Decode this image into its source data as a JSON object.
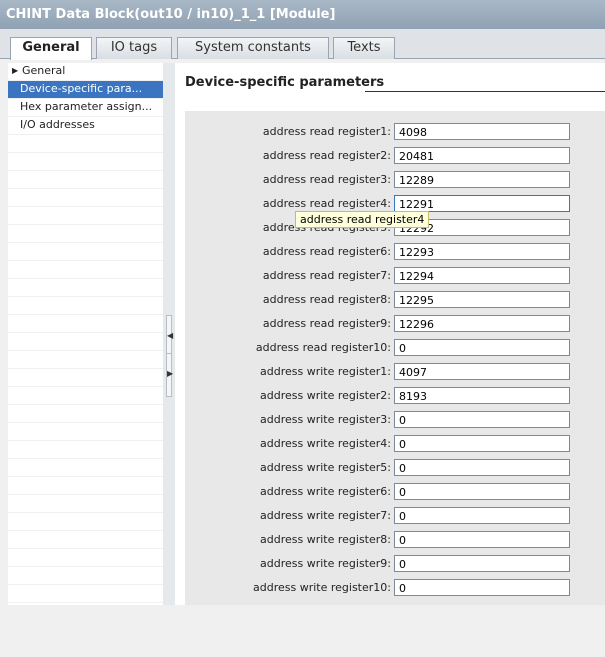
{
  "window": {
    "title": "CHINT Data Block(out10 / in10)_1_1 [Module]"
  },
  "tabs": [
    {
      "label": "General"
    },
    {
      "label": "IO tags"
    },
    {
      "label": "System constants"
    },
    {
      "label": "Texts"
    }
  ],
  "nav": {
    "items": [
      {
        "label": "General"
      },
      {
        "label": "Device-specific para..."
      },
      {
        "label": "Hex parameter assign..."
      },
      {
        "label": "I/O addresses"
      }
    ]
  },
  "section": {
    "title": "Device-specific parameters"
  },
  "params": [
    {
      "label": "address read register1:",
      "value": "4098"
    },
    {
      "label": "address read register2:",
      "value": "20481"
    },
    {
      "label": "address read register3:",
      "value": "12289"
    },
    {
      "label": "address read register4:",
      "value": "12291"
    },
    {
      "label": "address read register5:",
      "value": "12292"
    },
    {
      "label": "address read register6:",
      "value": "12293"
    },
    {
      "label": "address read register7:",
      "value": "12294"
    },
    {
      "label": "address read register8:",
      "value": "12295"
    },
    {
      "label": "address read register9:",
      "value": "12296"
    },
    {
      "label": "address read register10:",
      "value": "0"
    },
    {
      "label": "address write register1:",
      "value": "4097"
    },
    {
      "label": "address write register2:",
      "value": "8193"
    },
    {
      "label": "address write register3:",
      "value": "0"
    },
    {
      "label": "address write register4:",
      "value": "0"
    },
    {
      "label": "address write register5:",
      "value": "0"
    },
    {
      "label": "address write register6:",
      "value": "0"
    },
    {
      "label": "address write register7:",
      "value": "0"
    },
    {
      "label": "address write register8:",
      "value": "0"
    },
    {
      "label": "address write register9:",
      "value": "0"
    },
    {
      "label": "address write register10:",
      "value": "0"
    }
  ],
  "tooltip": {
    "text": "address read register4"
  }
}
